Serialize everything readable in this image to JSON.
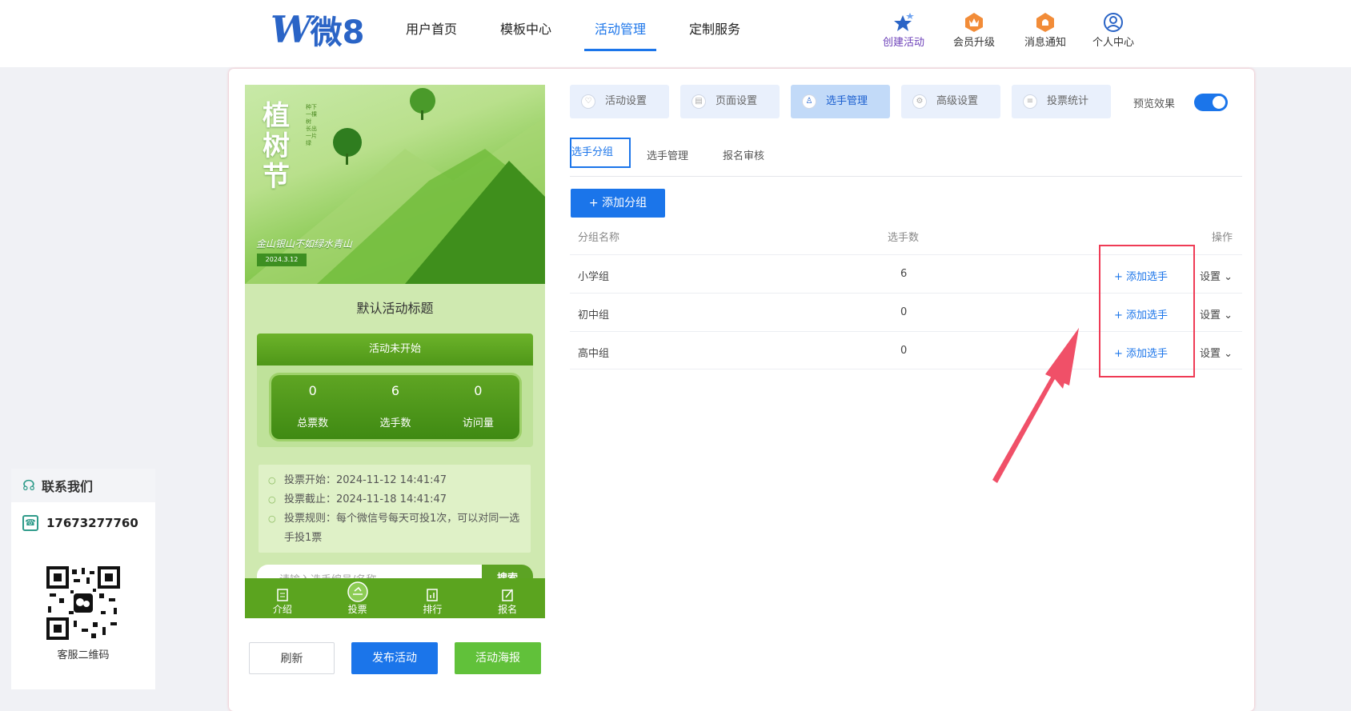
{
  "logo": {
    "text": "微8",
    "mark": "W"
  },
  "nav": [
    {
      "label": "用户首页"
    },
    {
      "label": "模板中心"
    },
    {
      "label": "活动管理"
    },
    {
      "label": "定制服务"
    }
  ],
  "user_nav": [
    {
      "label": "创建活动",
      "icon": "stars-icon"
    },
    {
      "label": "会员升级",
      "icon": "crown-badge-icon"
    },
    {
      "label": "消息通知",
      "icon": "bell-badge-icon"
    },
    {
      "label": "个人中心",
      "icon": "user-circle-icon"
    }
  ],
  "preview": {
    "hero_title": "植树节",
    "hero_vertical": "种下一棵树 长出一片绿",
    "slogan": "金山银山不如绿水青山",
    "date": "2024.3.12",
    "activity_title": "默认活动标题",
    "status": "活动未开始",
    "stats": [
      {
        "value": "0",
        "label": "总票数"
      },
      {
        "value": "6",
        "label": "选手数"
      },
      {
        "value": "0",
        "label": "访问量"
      }
    ],
    "info": [
      "投票开始：2024-11-12 14:41:47",
      "投票截止：2024-11-18 14:41:47",
      "投票规则：每个微信号每天可投1次，可以对同一选手投1票"
    ],
    "search_placeholder": "请输入选手编号/名称",
    "search_btn": "搜索",
    "tabbar": [
      {
        "label": "介绍"
      },
      {
        "label": "投票"
      },
      {
        "label": "排行"
      },
      {
        "label": "报名"
      }
    ]
  },
  "actions": {
    "refresh": "刷新",
    "publish": "发布活动",
    "poster": "活动海报"
  },
  "tabs": [
    {
      "label": "活动设置"
    },
    {
      "label": "页面设置"
    },
    {
      "label": "选手管理"
    },
    {
      "label": "高级设置"
    },
    {
      "label": "投票统计"
    }
  ],
  "preview_toggle": {
    "label": "预览效果",
    "on": true
  },
  "subtabs": [
    {
      "label": "选手分组"
    },
    {
      "label": "选手管理"
    },
    {
      "label": "报名审核"
    }
  ],
  "add_group": "+ 添加分组",
  "table": {
    "headers": [
      "分组名称",
      "选手数",
      "操作"
    ],
    "rows": [
      {
        "name": "小学组",
        "count": "6",
        "add": "+ 添加选手",
        "set": "设置"
      },
      {
        "name": "初中组",
        "count": "0",
        "add": "+ 添加选手",
        "set": "设置"
      },
      {
        "name": "高中组",
        "count": "0",
        "add": "+ 添加选手",
        "set": "设置"
      }
    ]
  },
  "contact": {
    "title": "联系我们",
    "phone": "17673277760",
    "qr_caption": "客服二维码"
  },
  "colors": {
    "accent": "#1b75ea",
    "green": "#5ba41f",
    "highlight": "#ef3b55"
  }
}
